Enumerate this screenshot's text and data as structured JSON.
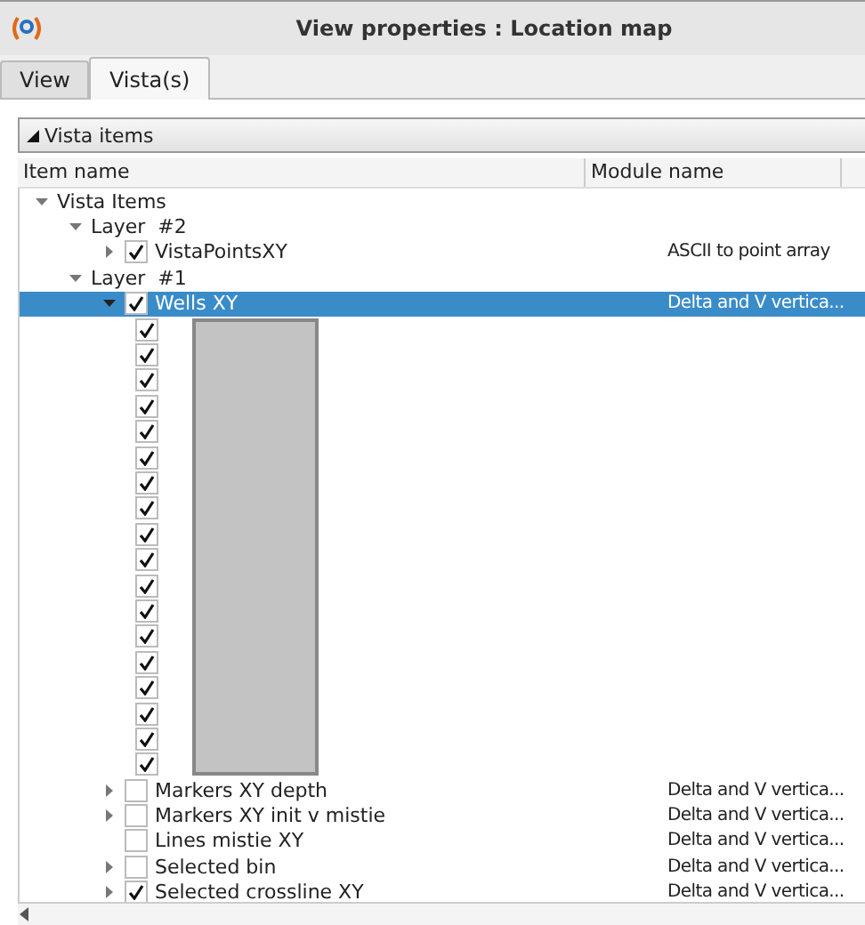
{
  "window": {
    "title": "View properties : Location map"
  },
  "tabs": [
    {
      "label": "View",
      "selected": false
    },
    {
      "label": "Vista(s)",
      "selected": true
    }
  ],
  "group": {
    "title": "Vista items",
    "expanded": true
  },
  "tree": {
    "columns": [
      "Item name",
      "Module name"
    ],
    "items": [
      {
        "name": "Vista Items",
        "expanded": true,
        "children": [
          {
            "name": "Layer  #2",
            "expanded": true,
            "children": [
              {
                "name": "VistaPointsXY",
                "module": "ASCII to point array",
                "expanded": false,
                "checked": true,
                "selected": false
              }
            ]
          },
          {
            "name": "Layer  #1",
            "expanded": true,
            "children": [
              {
                "name": "Wells XY",
                "module": "Delta and V vertica...",
                "expanded": true,
                "checked": true,
                "selected": true,
                "children": [
                  {
                    "checked": true
                  },
                  {
                    "checked": true
                  },
                  {
                    "checked": true
                  },
                  {
                    "checked": true
                  },
                  {
                    "checked": true
                  },
                  {
                    "checked": true
                  },
                  {
                    "checked": true
                  },
                  {
                    "checked": true
                  },
                  {
                    "checked": true
                  },
                  {
                    "checked": true
                  },
                  {
                    "checked": true
                  },
                  {
                    "checked": true
                  },
                  {
                    "checked": true
                  },
                  {
                    "checked": true
                  },
                  {
                    "checked": true
                  },
                  {
                    "checked": true
                  },
                  {
                    "checked": true
                  },
                  {
                    "checked": true
                  }
                ]
              },
              {
                "name": "Markers XY depth",
                "module": "Delta and V vertica...",
                "expanded": false,
                "checked": false,
                "selected": false
              },
              {
                "name": "Markers XY init v mistie",
                "module": "Delta and V vertica...",
                "expanded": false,
                "checked": false,
                "selected": false
              },
              {
                "name": "Lines mistie XY",
                "module": "Delta and V vertica...",
                "checked": false,
                "selected": false
              },
              {
                "name": "Selected bin",
                "module": "Delta and V vertica...",
                "expanded": false,
                "checked": false,
                "selected": false
              },
              {
                "name": "Selected crossline XY",
                "module": "Delta and V vertica...",
                "expanded": false,
                "checked": true,
                "selected": false
              }
            ]
          }
        ]
      }
    ]
  }
}
